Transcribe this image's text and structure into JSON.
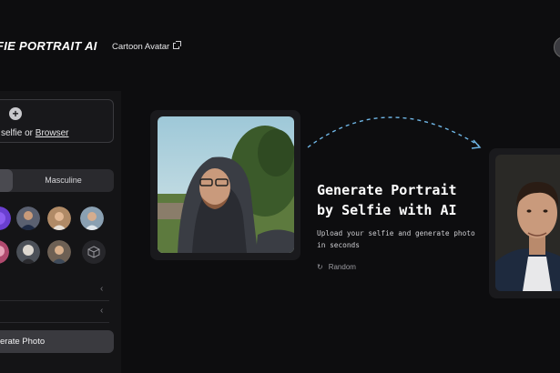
{
  "header": {
    "logo": "FIE PORTRAIT AI",
    "nav_link": "Cartoon Avatar"
  },
  "sidebar": {
    "upload_text_pre": "selfie or ",
    "upload_link": "Browser",
    "gender_option": "Masculine",
    "generate_button": "erate Photo"
  },
  "hero": {
    "headline_line1": "Generate Portrait",
    "headline_line2": "by Selfie with AI",
    "subtitle_line1": "Upload your selfie and generate photo",
    "subtitle_line2": "in seconds",
    "random_label": "Random"
  },
  "colors": {
    "background": "#0d0d0f",
    "sidebar": "#141416",
    "card": "#1a1a1d",
    "accent_arrow": "#6fb6e6"
  }
}
